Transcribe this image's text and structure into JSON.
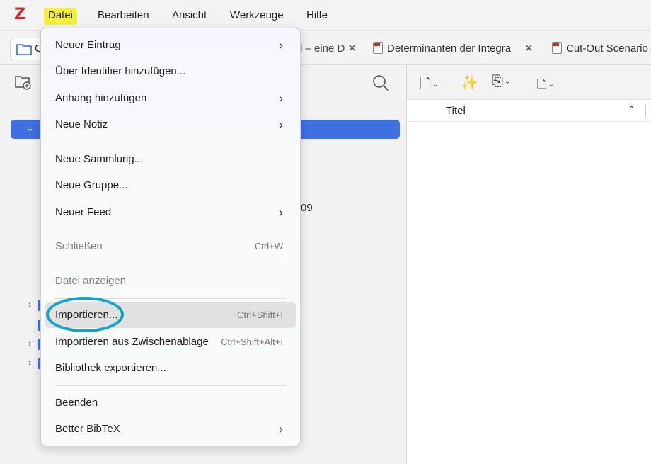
{
  "app": {
    "logo_letter": "Z",
    "accent": "#cc2936"
  },
  "menubar": {
    "items": [
      {
        "label": "Datei",
        "active": true
      },
      {
        "label": "Bearbeiten"
      },
      {
        "label": "Ansicht"
      },
      {
        "label": "Werkzeuge"
      },
      {
        "label": "Hilfe"
      }
    ]
  },
  "tabs": [
    {
      "label": "l – eine D",
      "icon": "pdf-icon"
    },
    {
      "label": "Determinanten der Integra",
      "icon": "pdf-icon"
    },
    {
      "label": "Cut-Out Scenario",
      "icon": "pdf-icon"
    }
  ],
  "tab_close_glyph": "✕",
  "home_tab_fragment": "C",
  "left_pane": {
    "visible_fragment": "09",
    "selected_color": "#3f6fe0"
  },
  "right_pane": {
    "column_title": "Titel"
  },
  "file_menu": {
    "items": [
      {
        "label": "Neuer Eintrag",
        "submenu": true
      },
      {
        "label": "Über Identifier hinzufügen..."
      },
      {
        "label": "Anhang hinzufügen",
        "submenu": true
      },
      {
        "label": "Neue Notiz",
        "submenu": true
      },
      {
        "label": "Neue Sammlung..."
      },
      {
        "label": "Neue Gruppe..."
      },
      {
        "label": "Neuer Feed",
        "submenu": true
      },
      {
        "label": "Schließen",
        "shortcut": "Ctrl+W",
        "disabled": true
      },
      {
        "label": "Datei anzeigen",
        "disabled": true
      },
      {
        "label": "Importieren...",
        "shortcut": "Ctrl+Shift+I",
        "highlighted": true
      },
      {
        "label": "Importieren aus Zwischenablage",
        "shortcut": "Ctrl+Shift+Alt+I"
      },
      {
        "label": "Bibliothek exportieren..."
      },
      {
        "label": "Beenden"
      },
      {
        "label": "Better BibTeX",
        "submenu": true
      }
    ],
    "submenu_glyph": "›",
    "annotation_color": "#12a2c6"
  }
}
